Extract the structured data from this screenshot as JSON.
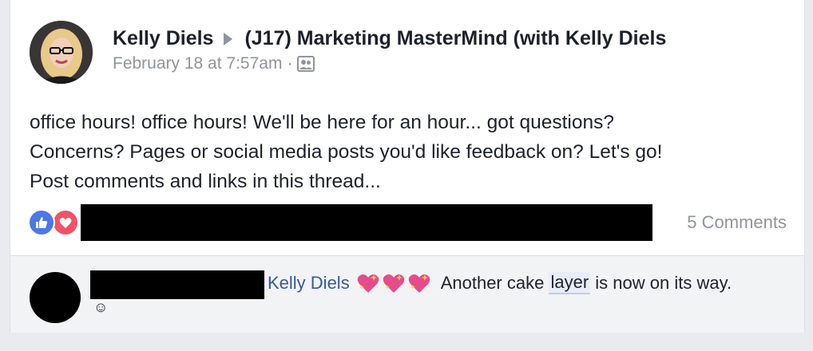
{
  "post": {
    "author": "Kelly Diels",
    "group": "(J17) Marketing MasterMind (with Kelly Diels",
    "timestamp": "February 18 at 7:57am",
    "separator": "·",
    "audience_icon": "group-audience-icon",
    "text_lines": [
      "office hours! office hours! We'll be here for an hour... got questions?",
      "Concerns? Pages or social media posts you'd like feedback on? Let's go!",
      "Post comments and links in this thread..."
    ],
    "reactions": [
      "like",
      "love"
    ],
    "comments_count": "5 Comments"
  },
  "comment": {
    "mention": "Kelly Diels",
    "hearts": [
      "sparkling-heart",
      "sparkling-heart",
      "sparkling-heart"
    ],
    "text_before": "Another cake",
    "highlight": "layer",
    "text_after": "is now on its way.",
    "emoji": "☺"
  },
  "colors": {
    "link_blue": "#385898",
    "like_blue": "#4a78e6",
    "love_red": "#f25268",
    "meta_gray": "#90949c"
  }
}
